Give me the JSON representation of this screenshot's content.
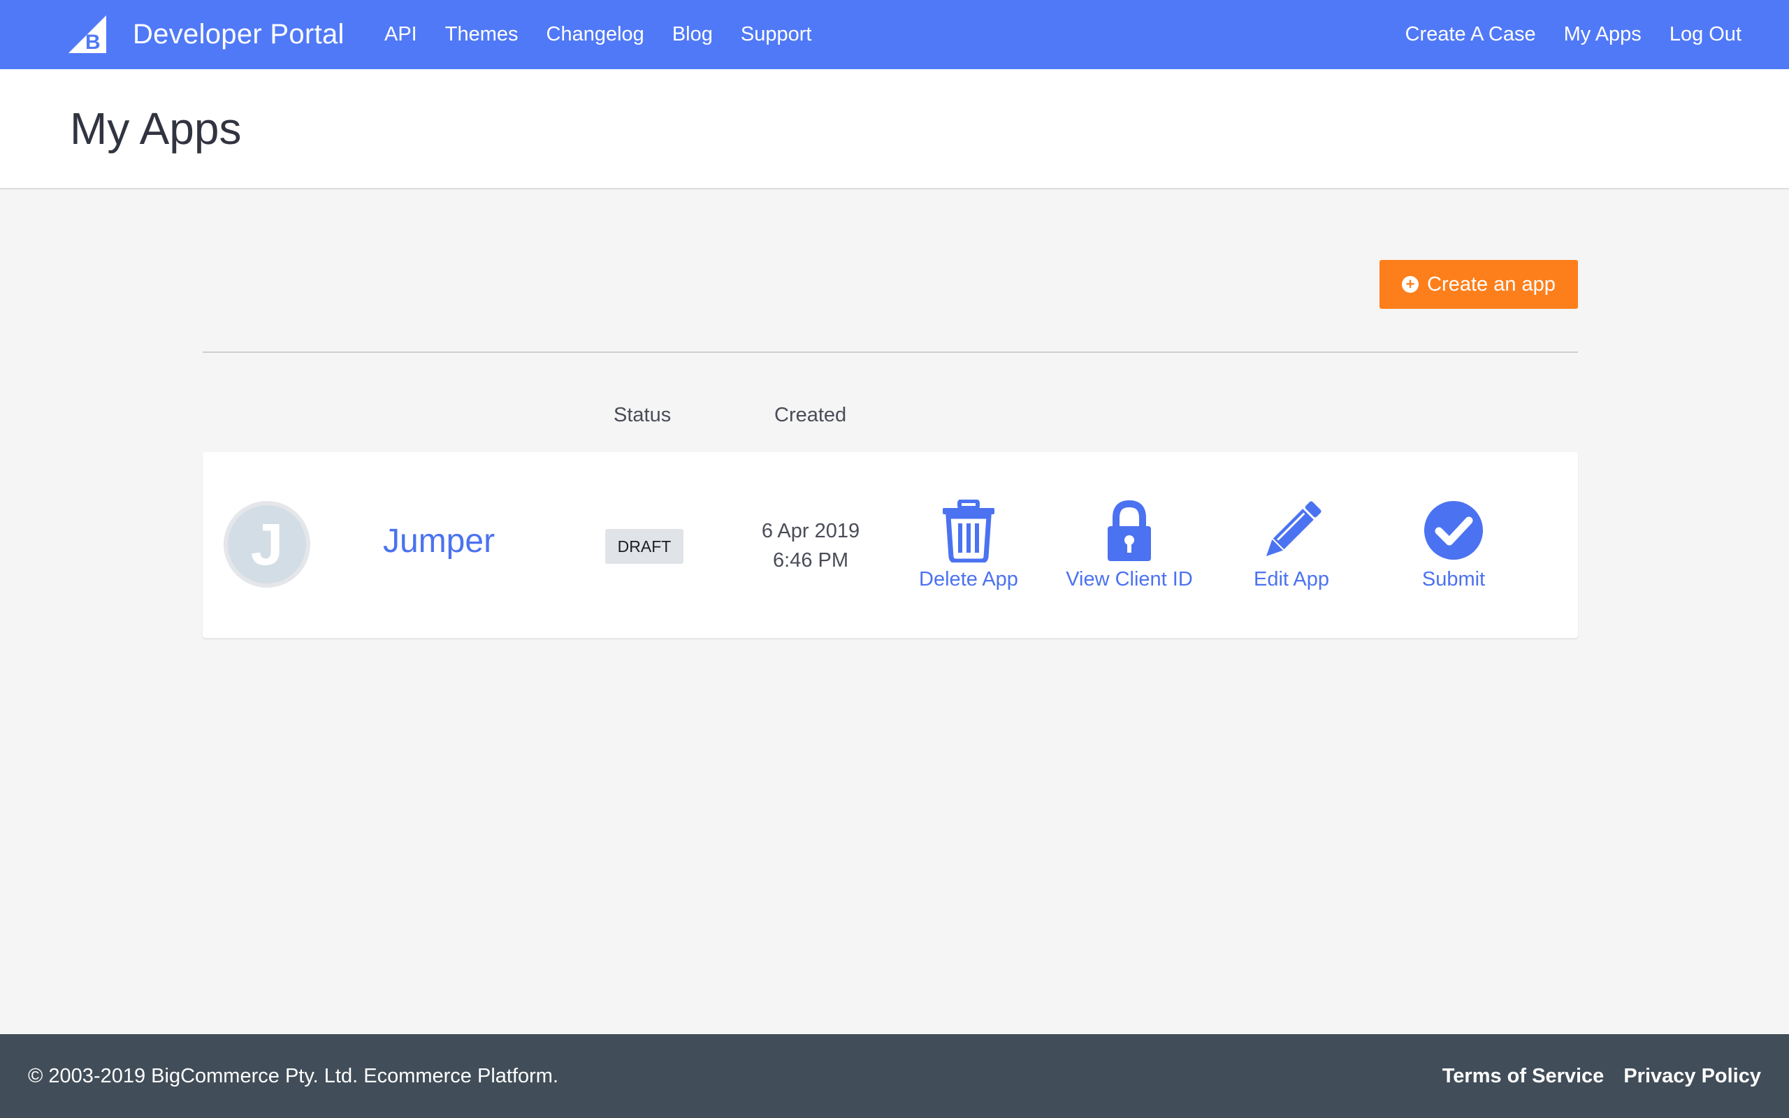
{
  "header": {
    "brand": "Developer Portal",
    "nav_left": [
      "API",
      "Themes",
      "Changelog",
      "Blog",
      "Support"
    ],
    "nav_right": [
      "Create A Case",
      "My Apps",
      "Log Out"
    ]
  },
  "page": {
    "title": "My Apps",
    "create_button": "Create an app"
  },
  "table": {
    "columns": {
      "status": "Status",
      "created": "Created"
    }
  },
  "apps": [
    {
      "avatar_letter": "J",
      "name": "Jumper",
      "status": "DRAFT",
      "created_date": "6 Apr 2019",
      "created_time": "6:46 PM",
      "actions": {
        "delete": "Delete App",
        "client_id": "View Client ID",
        "edit": "Edit App",
        "submit": "Submit"
      }
    }
  ],
  "footer": {
    "copyright": "© 2003-2019 BigCommerce Pty. Ltd. Ecommerce Platform.",
    "links": [
      "Terms of Service",
      "Privacy Policy"
    ]
  },
  "colors": {
    "nav_bg": "#5079f7",
    "accent_blue": "#4b72f0",
    "create_orange": "#fd7f1b",
    "footer_bg": "#414d58"
  }
}
